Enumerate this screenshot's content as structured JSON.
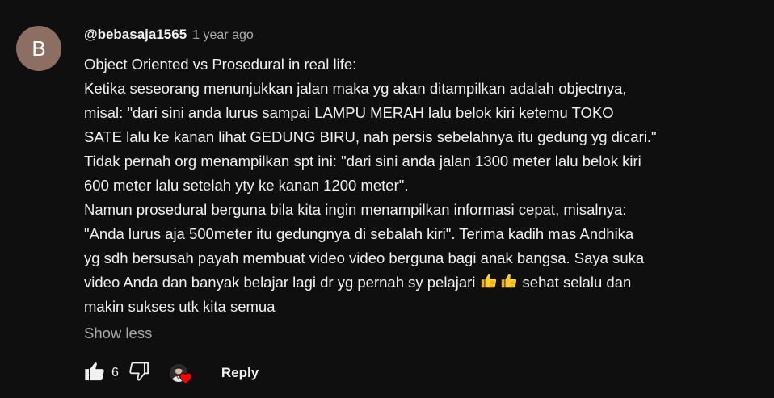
{
  "comment": {
    "avatar_letter": "B",
    "avatar_color": "#8d6e63",
    "author": "@bebasaja1565",
    "timestamp": "1 year ago",
    "lines": [
      "Object Oriented vs Prosedural in real life:",
      "Ketika seseorang menunjukkan jalan maka yg akan ditampilkan adalah objectnya,",
      "misal: \"dari sini anda lurus sampai LAMPU MERAH lalu belok kiri ketemu TOKO",
      "SATE lalu ke kanan lihat GEDUNG BIRU, nah persis sebelahnya itu gedung yg dicari.\"",
      "Tidak pernah org menampilkan spt ini: \"dari sini anda jalan 1300 meter lalu belok kiri",
      "600 meter lalu setelah yty ke kanan 1200 meter\".",
      "Namun prosedural berguna bila kita ingin menampilkan informasi cepat, misalnya:",
      "\"Anda lurus aja 500meter itu gedungnya di sebalah kiri\". Terima kadih mas Andhika",
      "yg sdh bersusah payah membuat video video berguna bagi anak bangsa. Saya suka"
    ],
    "line_with_emoji": {
      "before": "video Anda dan banyak belajar lagi dr yg pernah sy pelajari",
      "emoji": "thumbs-up-emoji",
      "after": " sehat selalu dan"
    },
    "last_line": "makin sukses utk kita semua",
    "show_less": "Show less"
  },
  "actions": {
    "like_count": "6",
    "like_icon": "thumbs-up-icon",
    "dislike_icon": "thumbs-down-icon",
    "creator_heart_icon": "creator-heart-icon",
    "heart_color": "#ff0000",
    "reply_label": "Reply"
  }
}
